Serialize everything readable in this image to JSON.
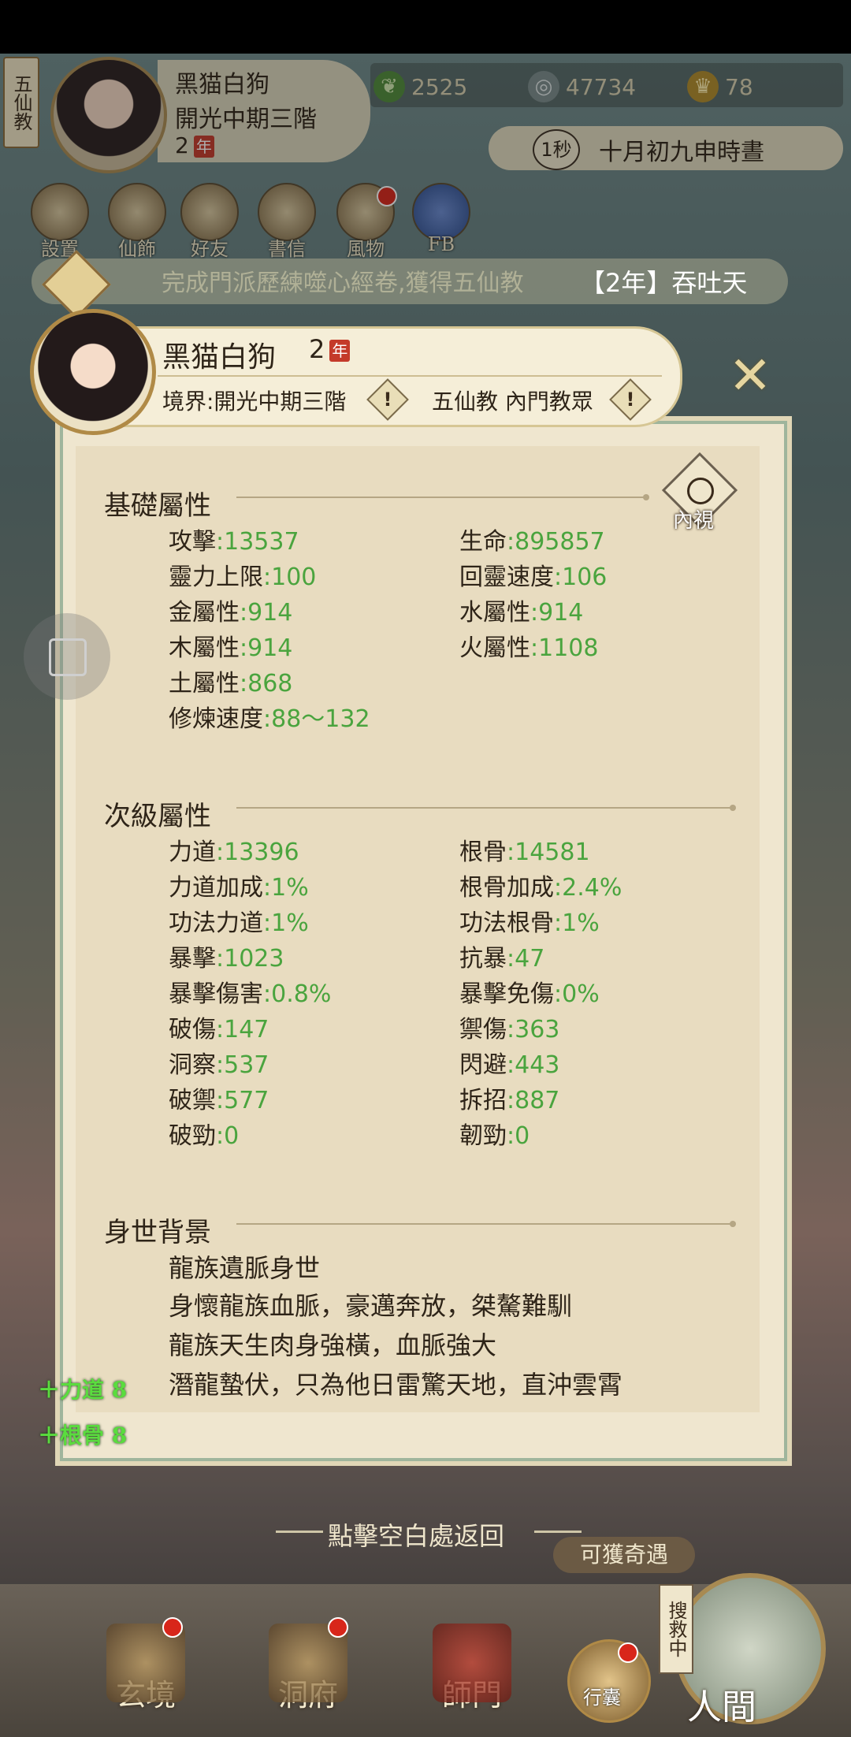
{
  "top": {
    "sect_tag": "五仙教",
    "player_name": "黑猫白狗",
    "realm": "開光中期三階",
    "level": "2",
    "nian": "年",
    "resources": [
      {
        "icon": "leaf-icon",
        "value": "2525"
      },
      {
        "icon": "coin-icon",
        "value": "47734"
      },
      {
        "icon": "ingot-icon",
        "value": "78"
      }
    ],
    "time_speed": "1秒",
    "game_date": "十月初九申時晝"
  },
  "menu": [
    {
      "label": "設置",
      "icon": "settings-icon"
    },
    {
      "label": "仙飾",
      "icon": "ornament-icon"
    },
    {
      "label": "好友",
      "icon": "friends-icon"
    },
    {
      "label": "書信",
      "icon": "letter-icon"
    },
    {
      "label": "風物",
      "icon": "scenery-icon"
    },
    {
      "label": "FB",
      "icon": "facebook-icon"
    }
  ],
  "notice": {
    "text": "完成門派歷練噬心經卷,獲得五仙教",
    "right_text": "【2年】吞吐天"
  },
  "character": {
    "name": "黑猫白狗",
    "level": "2",
    "nian": "年",
    "realm": "境界:開光中期三階",
    "sect": "五仙教 內門教眾",
    "close_label": "✕"
  },
  "inner_view_label": "內視",
  "basic": {
    "title": "基礎屬性",
    "left": [
      {
        "label": "攻擊",
        "value": ":13537"
      },
      {
        "label": "靈力上限",
        "value": ":100"
      },
      {
        "label": "金屬性",
        "value": ":914"
      },
      {
        "label": "木屬性",
        "value": ":914"
      },
      {
        "label": "土屬性",
        "value": ":868"
      },
      {
        "label": "修煉速度",
        "value": ":88～132"
      }
    ],
    "right": [
      {
        "label": "生命",
        "value": ":895857"
      },
      {
        "label": "回靈速度",
        "value": ":106"
      },
      {
        "label": "水屬性",
        "value": ":914"
      },
      {
        "label": "火屬性",
        "value": ":1108"
      }
    ]
  },
  "secondary": {
    "title": "次級屬性",
    "left": [
      {
        "label": "力道",
        "value": ":13396"
      },
      {
        "label": "力道加成",
        "value": ":1%"
      },
      {
        "label": "功法力道",
        "value": ":1%"
      },
      {
        "label": "暴擊",
        "value": ":1023"
      },
      {
        "label": "暴擊傷害",
        "value": ":0.8%"
      },
      {
        "label": "破傷",
        "value": ":147"
      },
      {
        "label": "洞察",
        "value": ":537"
      },
      {
        "label": "破禦",
        "value": ":577"
      },
      {
        "label": "破勁",
        "value": ":0"
      }
    ],
    "right": [
      {
        "label": "根骨",
        "value": ":14581"
      },
      {
        "label": "根骨加成",
        "value": ":2.4%"
      },
      {
        "label": "功法根骨",
        "value": ":1%"
      },
      {
        "label": "抗暴",
        "value": ":47"
      },
      {
        "label": "暴擊免傷",
        "value": ":0%"
      },
      {
        "label": "禦傷",
        "value": ":363"
      },
      {
        "label": "閃避",
        "value": ":443"
      },
      {
        "label": "拆招",
        "value": ":887"
      },
      {
        "label": "韌勁",
        "value": ":0"
      }
    ]
  },
  "background": {
    "title": "身世背景",
    "lines": [
      "龍族遺脈身世",
      "身懷龍族血脈，豪邁奔放，桀驁難馴",
      "龍族天生肉身強橫，血脈強大",
      "潛龍蟄伏，只為他日雷驚天地，直沖雲霄"
    ]
  },
  "gains": [
    "＋力道 8",
    "＋根骨 8"
  ],
  "return_hint": "點擊空白處返回",
  "chance_label": "可獲奇遇",
  "search_tag": "搜救中",
  "nav": [
    {
      "label": "玄境",
      "icon": "realm-icon"
    },
    {
      "label": "洞府",
      "icon": "cave-icon"
    },
    {
      "label": "師門",
      "icon": "sect-icon"
    },
    {
      "label": "行囊",
      "icon": "bag-icon"
    },
    {
      "label": "人間",
      "icon": "world-icon"
    }
  ]
}
